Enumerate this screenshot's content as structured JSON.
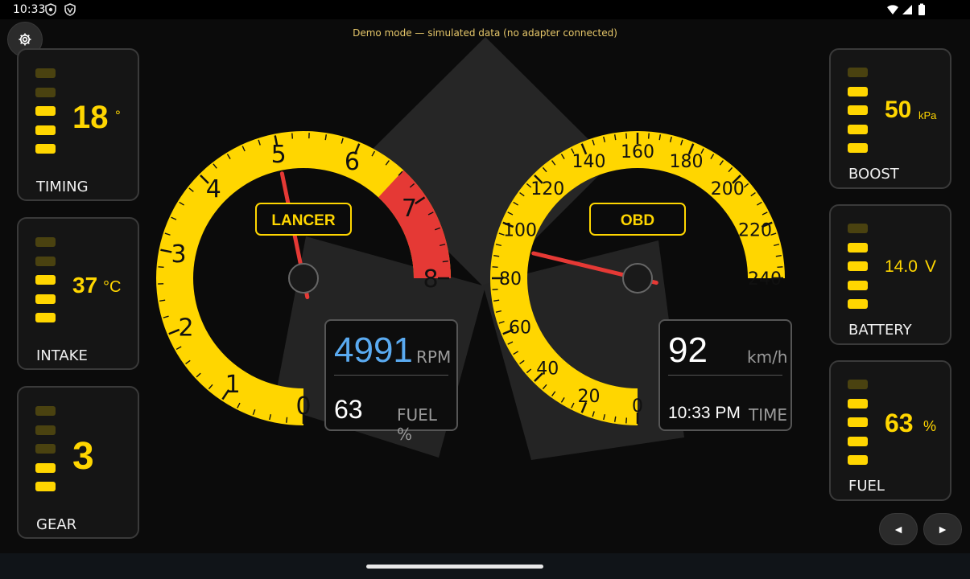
{
  "status": {
    "time": "10:33"
  },
  "banner": "Demo mode — simulated data (no adapter connected)",
  "left_cards": [
    {
      "value": "18",
      "unit": "°",
      "label": "TIMING",
      "level": 3,
      "max": 5
    },
    {
      "value": "37",
      "unit": "°C",
      "label": "INTAKE",
      "level": 3,
      "max": 5
    },
    {
      "value": "3",
      "unit": "",
      "label": "GEAR",
      "level": 2,
      "max": 5
    }
  ],
  "right_cards": [
    {
      "value": "50",
      "unit": "kPa",
      "label": "BOOST",
      "level": 4,
      "max": 5
    },
    {
      "value": "14.0",
      "unit": "V",
      "label": "BATTERY",
      "level": 4,
      "max": 5
    },
    {
      "value": "63",
      "unit": "%",
      "label": "FUEL",
      "level": 4,
      "max": 5
    }
  ],
  "tach": {
    "badge": "LANCER",
    "ticks": [
      "0",
      "1",
      "2",
      "3",
      "4",
      "5",
      "6",
      "7",
      "8"
    ],
    "redline_from": 6.6,
    "needle_value": 4.991,
    "colors": {
      "face": "#ffd600",
      "red": "#e53935",
      "needle": "#e53935"
    }
  },
  "speedo": {
    "badge": "OBD",
    "ticks": [
      "0",
      "20",
      "40",
      "60",
      "80",
      "100",
      "120",
      "140",
      "160",
      "180",
      "200",
      "220",
      "240"
    ],
    "needle_value": 92,
    "colors": {
      "face": "#ffd600",
      "needle": "#e53935"
    }
  },
  "rpm_box": {
    "rpm": "4991",
    "rpm_unit": "RPM",
    "fuel": "63",
    "fuel_unit": "FUEL %"
  },
  "speed_box": {
    "speed": "92",
    "speed_unit": "km/h",
    "time": "10:33 PM",
    "time_unit": "TIME"
  },
  "nav": {
    "prev": "◄",
    "next": "►"
  },
  "colors": {
    "accent": "#ffd600",
    "rpm": "#5aaaf0",
    "banner": "#e6c76a"
  }
}
